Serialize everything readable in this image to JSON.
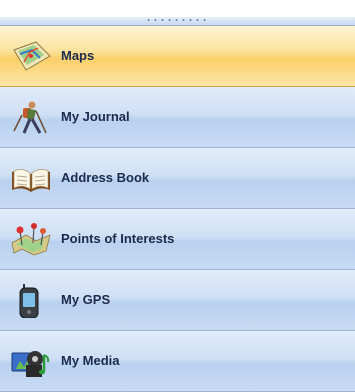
{
  "nav": {
    "items": [
      {
        "label": "Maps",
        "icon": "map-icon",
        "active": true
      },
      {
        "label": "My Journal",
        "icon": "hiker-icon",
        "active": false
      },
      {
        "label": "Address Book",
        "icon": "open-book-icon",
        "active": false
      },
      {
        "label": "Points of Interests",
        "icon": "map-pins-icon",
        "active": false
      },
      {
        "label": "My GPS",
        "icon": "gps-device-icon",
        "active": false
      },
      {
        "label": "My Media",
        "icon": "media-icon",
        "active": false
      }
    ]
  },
  "colors": {
    "active_item": "#fbd27a",
    "item": "#c9dcf3",
    "label": "#1b2a4e"
  }
}
